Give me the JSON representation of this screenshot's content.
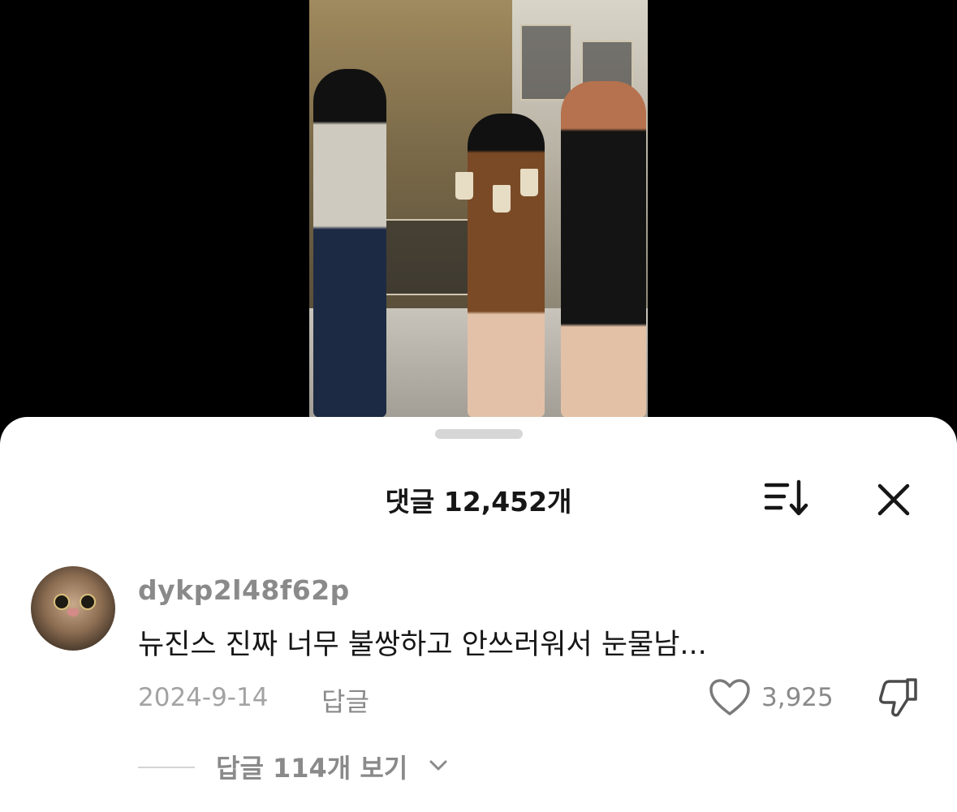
{
  "video": {
    "description_icon": "video-frame"
  },
  "sheet": {
    "title": "댓글 12,452개",
    "sort_icon": "sort-icon",
    "close_icon": "close-icon"
  },
  "comment": {
    "username": "dykp2l48f62p",
    "text": "뉴진스 진짜 너무 불쌍하고 안쓰러워서 눈물남...",
    "date": "2024-9-14",
    "reply_label": "답글",
    "like_count": "3,925",
    "like_icon": "heart-icon",
    "dislike_icon": "thumbs-down-icon",
    "view_replies_label": "답글 114개 보기"
  },
  "colors": {
    "sheet_bg": "#ffffff",
    "muted_text": "#8a8a8a",
    "primary_text": "#161616"
  }
}
